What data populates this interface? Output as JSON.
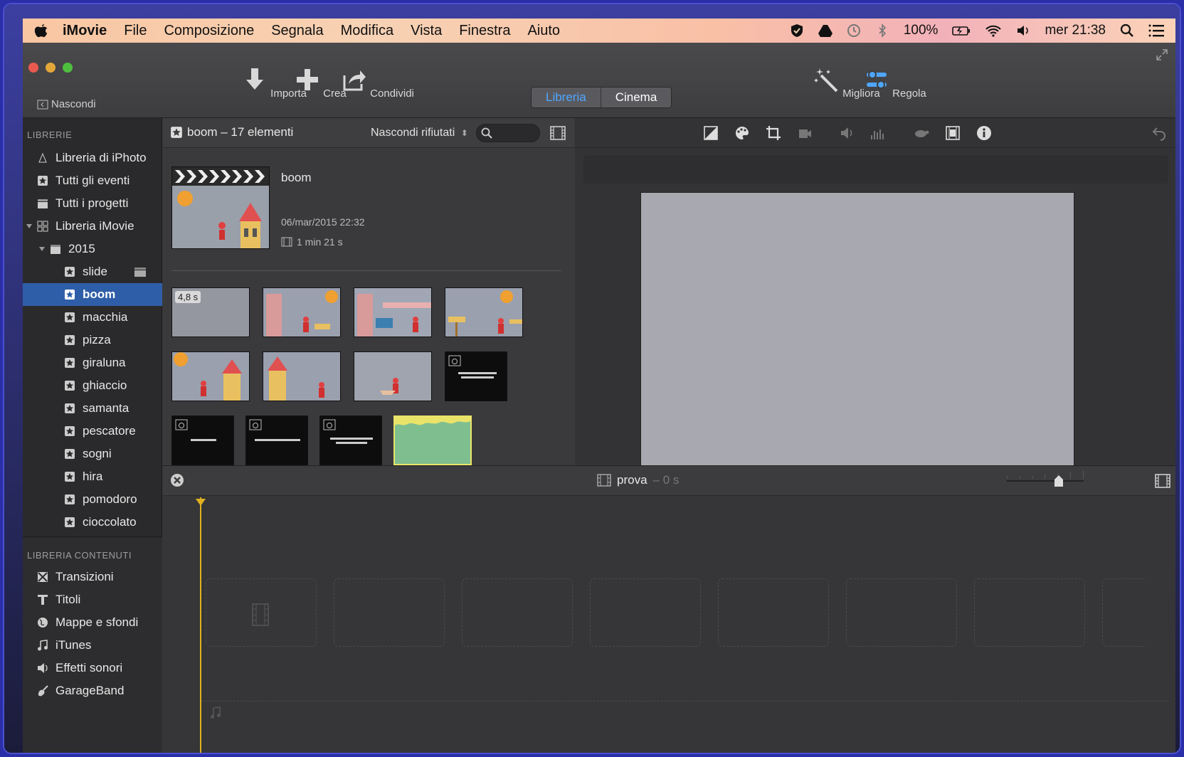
{
  "menubar": {
    "app": "iMovie",
    "menus": [
      "File",
      "Composizione",
      "Segnala",
      "Modifica",
      "Vista",
      "Finestra",
      "Aiuto"
    ],
    "battery": "100%",
    "clock": "mer 21:38"
  },
  "toolbar": {
    "hide": "Nascondi",
    "import": "Importa",
    "create": "Crea",
    "share": "Condividi",
    "seg_library": "Libreria",
    "seg_theater": "Cinema",
    "enhance": "Migliora",
    "adjust": "Regola"
  },
  "sidebar": {
    "libraries_header": "LIBRERIE",
    "items": [
      {
        "label": "Libreria di iPhoto"
      },
      {
        "label": "Tutti gli eventi"
      },
      {
        "label": "Tutti i progetti"
      },
      {
        "label": "Libreria iMovie"
      },
      {
        "label": "2015"
      },
      {
        "label": "slide"
      },
      {
        "label": "boom"
      },
      {
        "label": "macchia"
      },
      {
        "label": "pizza"
      },
      {
        "label": "giraluna"
      },
      {
        "label": "ghiaccio"
      },
      {
        "label": "samanta"
      },
      {
        "label": "pescatore"
      },
      {
        "label": "sogni"
      },
      {
        "label": "hira"
      },
      {
        "label": "pomodoro"
      },
      {
        "label": "cioccolato"
      }
    ],
    "content_header": "LIBRERIA CONTENUTI",
    "content_items": [
      {
        "label": "Transizioni"
      },
      {
        "label": "Titoli"
      },
      {
        "label": "Mappe e sfondi"
      },
      {
        "label": "iTunes"
      },
      {
        "label": "Effetti sonori"
      },
      {
        "label": "GarageBand"
      }
    ]
  },
  "browser": {
    "title": "boom  –  17 elementi",
    "filter": "Nascondi rifiutati",
    "event_name": "boom",
    "event_date": "06/mar/2015 22:32",
    "event_duration": "1 min 21 s",
    "first_clip_duration": "4,8 s"
  },
  "timeline": {
    "project": "prova",
    "project_duration": "– 0 s"
  },
  "colors": {
    "accent": "#2f5ea8",
    "segment_active": "#4ea6ff",
    "playhead": "#e0b020"
  }
}
